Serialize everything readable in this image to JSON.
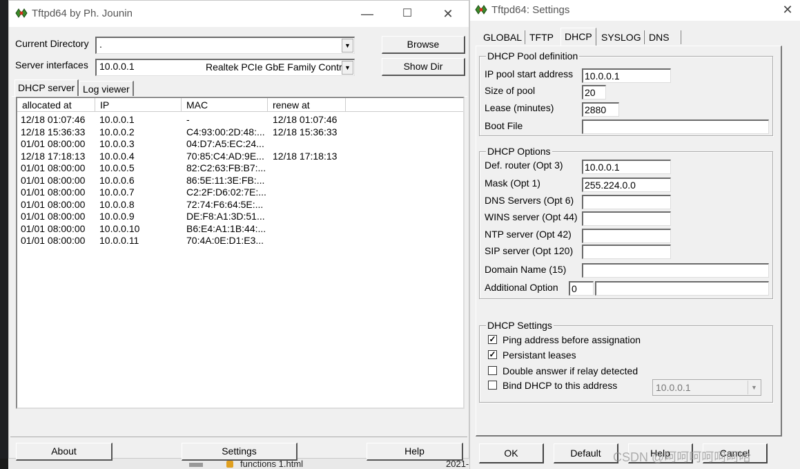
{
  "background": {
    "file_name": "functions 1.html",
    "file_date": "2021-"
  },
  "main_window": {
    "title": "Tftpd64 by Ph. Jounin",
    "controls": {
      "minimize": "—",
      "maximize": "☐",
      "close": "✕"
    },
    "current_directory_label": "Current Directory",
    "current_directory_value": ".",
    "server_interfaces_label": "Server interfaces",
    "server_interfaces_ip": "10.0.0.1",
    "server_interfaces_adapter": "Realtek PCIe GbE Family Contro",
    "browse_button": "Browse",
    "show_dir_button": "Show Dir",
    "tabs": [
      "DHCP server",
      "Log viewer"
    ],
    "columns": [
      "allocated at",
      "IP",
      "MAC",
      "renew at"
    ],
    "rows": [
      [
        "12/18 01:07:46",
        "10.0.0.1",
        "-",
        "12/18 01:07:46"
      ],
      [
        "12/18 15:36:33",
        "10.0.0.2",
        "C4:93:00:2D:48:...",
        "12/18 15:36:33"
      ],
      [
        "01/01 08:00:00",
        "10.0.0.3",
        "04:D7:A5:EC:24...",
        ""
      ],
      [
        "12/18 17:18:13",
        "10.0.0.4",
        "70:85:C4:AD:9E...",
        "12/18 17:18:13"
      ],
      [
        "01/01 08:00:00",
        "10.0.0.5",
        "82:C2:63:FB:B7:...",
        ""
      ],
      [
        "01/01 08:00:00",
        "10.0.0.6",
        "86:5E:11:3E:FB:...",
        ""
      ],
      [
        "01/01 08:00:00",
        "10.0.0.7",
        "C2:2F:D6:02:7E:...",
        ""
      ],
      [
        "01/01 08:00:00",
        "10.0.0.8",
        "72:74:F6:64:5E:...",
        ""
      ],
      [
        "01/01 08:00:00",
        "10.0.0.9",
        "DE:F8:A1:3D:51...",
        ""
      ],
      [
        "01/01 08:00:00",
        "10.0.0.10",
        "B6:E4:A1:1B:44:...",
        ""
      ],
      [
        "01/01 08:00:00",
        "10.0.0.11",
        "70:4A:0E:D1:E3...",
        ""
      ]
    ],
    "about_button": "About",
    "settings_button": "Settings",
    "help_button": "Help"
  },
  "settings_window": {
    "title": "Tftpd64: Settings",
    "close": "✕",
    "tabs": [
      "GLOBAL",
      "TFTP",
      "DHCP",
      "SYSLOG",
      "DNS"
    ],
    "active_tab": "DHCP",
    "pool_group": {
      "title": "DHCP Pool definition",
      "ip_start_label": "IP pool start address",
      "ip_start_value": "10.0.0.1",
      "size_label": "Size of pool",
      "size_value": "20",
      "lease_label": "Lease (minutes)",
      "lease_value": "2880",
      "boot_label": "Boot File",
      "boot_value": ""
    },
    "options_group": {
      "title": "DHCP Options",
      "router_label": "Def. router (Opt 3)",
      "router_value": "10.0.0.1",
      "mask_label": "Mask (Opt 1)",
      "mask_value": "255.224.0.0",
      "dns_label": "DNS Servers (Opt 6)",
      "dns_value": "",
      "wins_label": "WINS server (Opt 44)",
      "wins_value": "",
      "ntp_label": "NTP server (Opt 42)",
      "ntp_value": "",
      "sip_label": "SIP server (Opt 120)",
      "sip_value": "",
      "domain_label": "Domain Name (15)",
      "domain_value": "",
      "additional_label": "Additional Option",
      "additional_num": "0",
      "additional_value": ""
    },
    "settings_group": {
      "title": "DHCP Settings",
      "ping_label": "Ping address before assignation",
      "ping_checked": true,
      "persistant_label": "Persistant leases",
      "persistant_checked": true,
      "double_label": "Double answer if relay detected",
      "double_checked": false,
      "bind_label": "Bind DHCP to this address",
      "bind_checked": false,
      "bind_address": "10.0.0.1"
    },
    "ok_button": "OK",
    "default_button": "Default",
    "help_button": "Help",
    "cancel_button": "Cancel"
  },
  "watermark": "CSDN @呵呵呵呵呵呵哈"
}
